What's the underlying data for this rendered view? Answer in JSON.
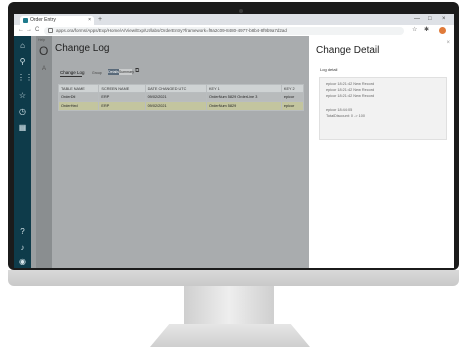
{
  "browser": {
    "tab_title": "Order Entry",
    "tab_close": "×",
    "new_tab": "+",
    "win_min": "—",
    "win_max": "□",
    "win_close": "×",
    "nav_back": "←",
    "nav_forward": "→",
    "nav_reload": "C",
    "url": "apps.ora/forms/Apps/Exp/Home/A/View/Exp/UI/labs/OrderEntry?framework=f9a2c09-8480-4977-b8b4-8f9b9a7d2ad",
    "star": "☆",
    "ext": "✱"
  },
  "sidebar": {
    "icons": [
      "home-icon",
      "search-icon",
      "grid-icon",
      "star-icon",
      "history-icon",
      "apps-icon",
      "help-icon",
      "notification-icon",
      "user-icon"
    ]
  },
  "back_page": {
    "label": "Help",
    "title_initial": "O",
    "text": "A"
  },
  "change_log": {
    "title": "Change Log",
    "tab_label": "Change Log",
    "toggle_label": "Group",
    "toggle_a": "Details",
    "toggle_b": "Summary",
    "export_icon": "export-icon",
    "columns": [
      "Table Name",
      "Screen Name",
      "Date Changed UTC",
      "Key 1",
      "Key 2"
    ],
    "rows": [
      [
        "OrderDtl",
        "ERP",
        "09/02/2021",
        "OrderNum 5829 OrderLine 3",
        "epicor"
      ],
      [
        "OrderHed",
        "ERP",
        "09/02/2021",
        "OrderNum 5829",
        "epicor"
      ]
    ]
  },
  "change_detail": {
    "title": "Change Detail",
    "close": "×",
    "log_label": "Log detail",
    "lines": [
      "epicor  18:21:42 New Record",
      "epicor  18:21:42 New Record",
      "epicor  18:21:42 New Record",
      "",
      "epicor  18:44:05",
      "TotalDiscount: 0 -> 100"
    ]
  }
}
